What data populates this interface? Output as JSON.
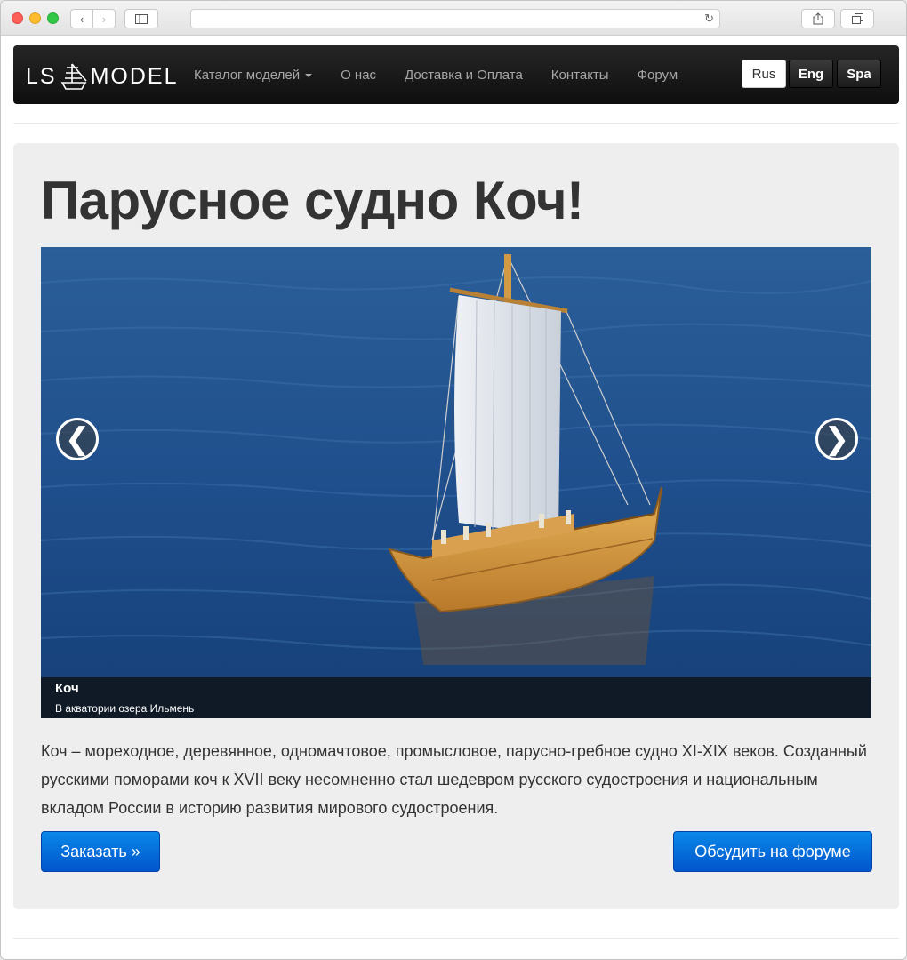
{
  "browser": {
    "icons": {
      "back": "chevron-left-icon",
      "forward": "chevron-right-icon",
      "sidebar": "sidebar-icon",
      "reload": "reload-icon",
      "share": "share-icon",
      "tabs": "tabs-icon"
    }
  },
  "navbar": {
    "logo_left": "LS",
    "logo_right": "MODEL",
    "links": [
      {
        "label": "Каталог моделей",
        "dropdown": true
      },
      {
        "label": "О нас"
      },
      {
        "label": "Доставка и Оплата"
      },
      {
        "label": "Контакты"
      },
      {
        "label": "Форум"
      }
    ],
    "languages": [
      "Rus",
      "Eng",
      "Spa"
    ],
    "active_language": "Rus"
  },
  "hero": {
    "title": "Парусное судно Коч!",
    "carousel": {
      "prev": "❮",
      "next": "❯",
      "caption_title": "Коч",
      "caption_text": "В акватории озера Ильмень"
    },
    "description": "Коч – мореходное, деревянное, одномачтовое, промысловое, парусно-гребное судно XI-XIX веков. Созданный русскими поморами коч к XVII веку несомненно стал шедевром русского судостроения и национальным вкладом России в историю развития мирового судостроения.",
    "order_button": "Заказать »",
    "forum_button": "Обсудить на форуме"
  },
  "colors": {
    "primary": "#0a6fdc",
    "navbar": "#1a1a1a",
    "jumbotron": "#eeeeee"
  }
}
